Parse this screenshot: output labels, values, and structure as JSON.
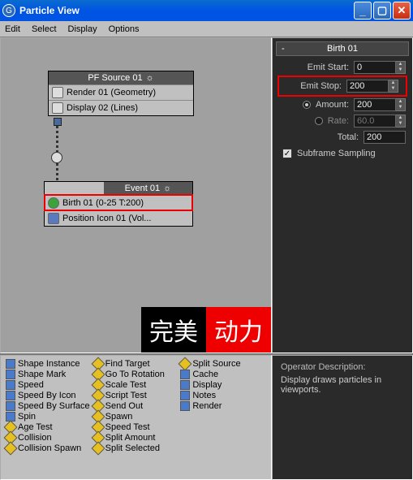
{
  "titlebar": {
    "title": "Particle View"
  },
  "menu": {
    "edit": "Edit",
    "select": "Select",
    "display": "Display",
    "options": "Options"
  },
  "pf_source": {
    "title": "PF Source 01",
    "rows": [
      {
        "label": "Render 01 (Geometry)"
      },
      {
        "label": "Display 02 (Lines)"
      }
    ]
  },
  "event": {
    "title": "Event 01",
    "rows": [
      {
        "label": "Birth 01 (0-25 T:200)"
      },
      {
        "label": "Position Icon 01 (Vol..."
      }
    ]
  },
  "rollout": {
    "title": "Birth 01"
  },
  "params": {
    "emit_start": {
      "label": "Emit Start:",
      "value": "0"
    },
    "emit_stop": {
      "label": "Emit Stop:",
      "value": "200"
    },
    "amount": {
      "label": "Amount:",
      "value": "200"
    },
    "rate": {
      "label": "Rate:",
      "value": "60.0"
    },
    "total": {
      "label": "Total:",
      "value": "200"
    },
    "subframe": {
      "label": "Subframe Sampling",
      "checked": true
    }
  },
  "watermark": {
    "left": "完美",
    "right": "动力"
  },
  "depot": {
    "col1": [
      {
        "c": "b",
        "t": "Shape Instance"
      },
      {
        "c": "b",
        "t": "Shape Mark"
      },
      {
        "c": "b",
        "t": "Speed"
      },
      {
        "c": "b",
        "t": "Speed By Icon"
      },
      {
        "c": "b",
        "t": "Speed By Surface"
      },
      {
        "c": "b",
        "t": "Spin"
      },
      {
        "c": "y",
        "t": "Age Test"
      },
      {
        "c": "y",
        "t": "Collision"
      },
      {
        "c": "y",
        "t": "Collision Spawn"
      }
    ],
    "col2": [
      {
        "c": "y",
        "t": "Find Target"
      },
      {
        "c": "y",
        "t": "Go To Rotation"
      },
      {
        "c": "y",
        "t": "Scale Test"
      },
      {
        "c": "y",
        "t": "Script Test"
      },
      {
        "c": "y",
        "t": "Send Out"
      },
      {
        "c": "y",
        "t": "Spawn"
      },
      {
        "c": "y",
        "t": "Speed Test"
      },
      {
        "c": "y",
        "t": "Split Amount"
      },
      {
        "c": "y",
        "t": "Split Selected"
      }
    ],
    "col3": [
      {
        "c": "y",
        "t": "Split Source"
      },
      {
        "c": "b",
        "t": "Cache"
      },
      {
        "c": "b",
        "t": "Display"
      },
      {
        "c": "b",
        "t": "Notes"
      },
      {
        "c": "b",
        "t": "Render"
      }
    ]
  },
  "desc": {
    "heading": "Operator Description:",
    "body": "Display draws particles in viewports."
  }
}
